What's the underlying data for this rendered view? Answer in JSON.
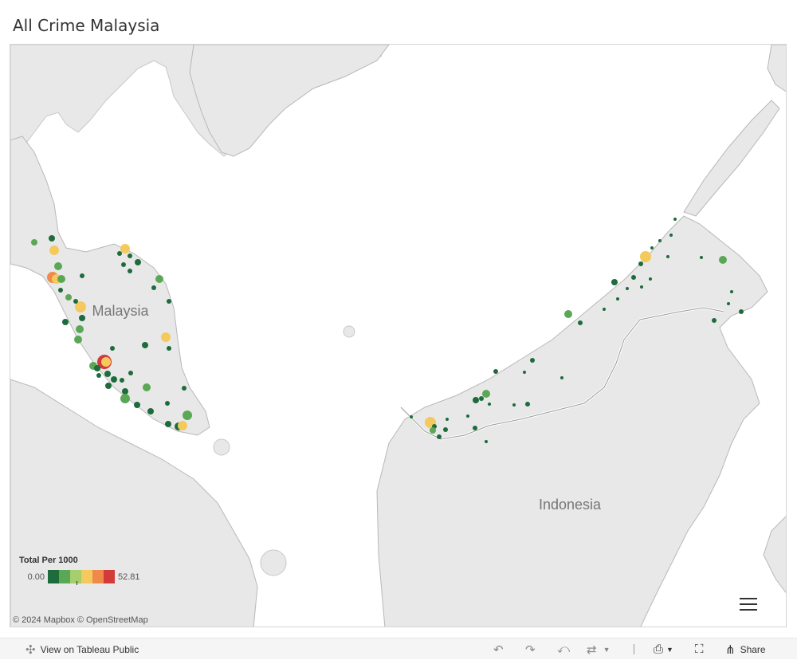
{
  "title": "All Crime Malaysia",
  "map": {
    "labels": {
      "malaysia": "Malaysia",
      "indonesia": "Indonesia"
    },
    "colors": {
      "water": "#ffffff",
      "land": "#e8e8e8",
      "border": "#b8b8b8"
    },
    "legend": {
      "title": "Total Per 1000",
      "min": "0.00",
      "max": "52.81",
      "colors": [
        "#1e6b3c",
        "#5aa855",
        "#a6cd6e",
        "#f4c95d",
        "#ef8a4a",
        "#d33a3a"
      ]
    },
    "attribution": "© 2024 Mapbox  © OpenStreetMap",
    "marks_icon": "circle-mark"
  },
  "toolbar": {
    "view_label": "View on Tableau Public",
    "view_icon": "tableau-icon",
    "undo_icon": "undo-icon",
    "redo_icon": "redo-icon",
    "revert_icon": "revert-icon",
    "refresh_icon": "refresh-icon",
    "download_icon": "download-icon",
    "fullscreen_icon": "fullscreen-icon",
    "share_icon": "share-icon",
    "share_label": "Share"
  }
}
